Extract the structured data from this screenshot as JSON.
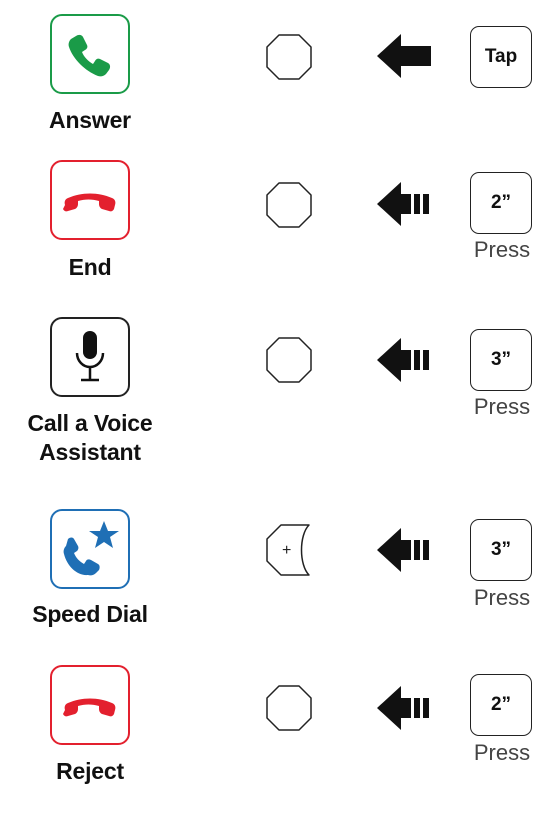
{
  "rows": [
    {
      "function": "Answer",
      "icon": "green-phone-icon",
      "icon_color": "#1a9b48",
      "button": "center-button",
      "arrow": "tap-arrow",
      "action": "Tap",
      "press_label": ""
    },
    {
      "function": "End",
      "icon": "red-hang-up-icon",
      "icon_color": "#e3202e",
      "button": "center-button",
      "arrow": "press-hold-arrow",
      "action": "2”",
      "press_label": "Press"
    },
    {
      "function": "Call a Voice Assistant",
      "icon": "microphone-icon",
      "icon_color": "#111111",
      "button": "center-button",
      "arrow": "press-hold-arrow",
      "action": "3”",
      "press_label": "Press"
    },
    {
      "function": "Speed Dial",
      "icon": "blue-speed-dial-icon",
      "icon_color": "#1f6fb5",
      "button": "plus-button",
      "button_symbol": "+",
      "arrow": "press-hold-arrow",
      "action": "3”",
      "press_label": "Press"
    },
    {
      "function": "Reject",
      "icon": "red-hang-up-icon",
      "icon_color": "#e3202e",
      "button": "center-button",
      "arrow": "press-hold-arrow",
      "action": "2”",
      "press_label": "Press"
    }
  ]
}
